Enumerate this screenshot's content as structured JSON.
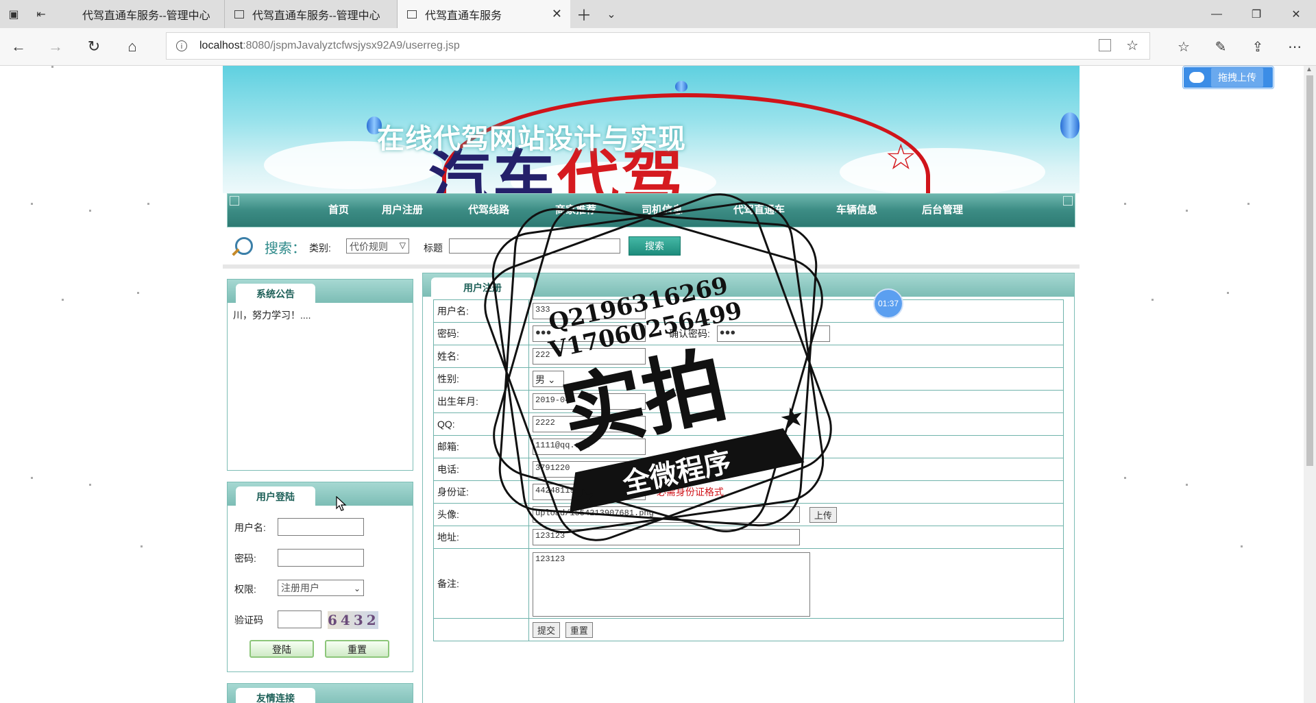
{
  "browser": {
    "tabs": [
      {
        "title": "代驾直通车服务--管理中心"
      },
      {
        "title": "代驾直通车服务--管理中心"
      },
      {
        "title": "代驾直通车服务"
      }
    ],
    "url_host": "localhost",
    "url_rest": ":8080/jspmJavalyztcfwsjysx92A9/userreg.jsp"
  },
  "overlay": {
    "upload_label": "拖拽上传",
    "timer": "01:37",
    "stamp_line1": "Q2196316269",
    "stamp_line2": "V17060256499",
    "stamp_big": "实拍",
    "stamp_ribbon": "全微程序"
  },
  "banner": {
    "site_title": "在线代驾网站设计与实现",
    "big_text_a": "汽车",
    "big_text_b": "代驾"
  },
  "nav": {
    "items": [
      "首页",
      "用户注册",
      "代驾线路",
      "商家推荐",
      "司机信息",
      "代驾直通车",
      "车辆信息",
      "后台管理"
    ]
  },
  "search": {
    "label": "搜索：",
    "category_label": "类别:",
    "category_value": "代价规则",
    "title_label": "标题",
    "title_value": "",
    "button": "搜索"
  },
  "notice": {
    "title": "系统公告",
    "text": "川，努力学习！...."
  },
  "login": {
    "title": "用户登陆",
    "username_label": "用户名:",
    "password_label": "密码:",
    "role_label": "权限:",
    "role_value": "注册用户",
    "captcha_label": "验证码",
    "captcha_value": "6432",
    "login_button": "登陆",
    "reset_button": "重置"
  },
  "links": {
    "title": "友情连接"
  },
  "register": {
    "title": "用户注册",
    "fields": {
      "username_label": "用户名:",
      "username_value": "333",
      "password_label": "密码:",
      "password_value": "●●●",
      "confirm_label": "确认密码:",
      "confirm_value": "●●●",
      "name_label": "姓名:",
      "name_value": "222",
      "gender_label": "性别:",
      "gender_value": "男",
      "birth_label": "出生年月:",
      "birth_value": "2019-04",
      "qq_label": "QQ:",
      "qq_value": "2222",
      "email_label": "邮箱:",
      "email_value": "1111@qq.com",
      "phone_label": "电话:",
      "phone_value": "3791220",
      "id_label": "身份证:",
      "id_value": "44248119",
      "id_error": "必需身份证格式",
      "avatar_label": "头像:",
      "avatar_value": "upload/1554213907681.png",
      "upload_button": "上传",
      "address_label": "地址:",
      "address_value": "123123",
      "remark_label": "备注:",
      "remark_value": "123123",
      "submit_button": "提交",
      "reset_button": "重置"
    }
  }
}
